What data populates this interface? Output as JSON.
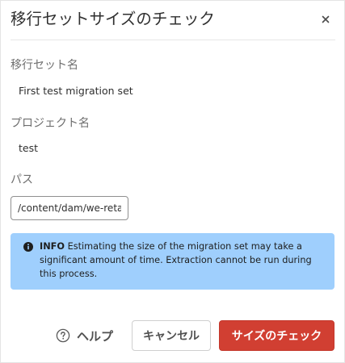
{
  "dialog": {
    "title": "移行セットサイズのチェック"
  },
  "fields": {
    "migration_set": {
      "label": "移行セット名",
      "value": "First test migration set"
    },
    "project": {
      "label": "プロジェクト名",
      "value": "test"
    },
    "path": {
      "label": "パス",
      "value": "/content/dam/we-retail"
    }
  },
  "info": {
    "heading": "INFO",
    "message": "Estimating the size of the migration set may take a significant amount of time. Extraction cannot be run during this process.",
    "background_color": "#9fcffd"
  },
  "footer": {
    "help_label": "ヘルプ",
    "cancel_label": "キャンセル",
    "primary_label": "サイズのチェック",
    "primary_color": "#d13f32"
  },
  "icons": {
    "close": "close-icon",
    "info": "info-icon",
    "help": "help-circle-icon"
  }
}
